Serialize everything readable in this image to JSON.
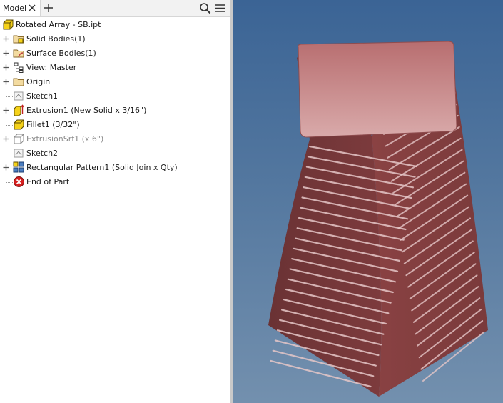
{
  "tabs": {
    "model_label": "Model"
  },
  "tree": {
    "root": "Rotated Array - SB.ipt",
    "items": [
      {
        "label": "Solid Bodies(1)",
        "icon": "solid-bodies-folder-icon",
        "expandable": true,
        "dim": false
      },
      {
        "label": "Surface Bodies(1)",
        "icon": "surface-bodies-folder-icon",
        "expandable": true,
        "dim": false
      },
      {
        "label": "View: Master",
        "icon": "view-representation-icon",
        "expandable": true,
        "dim": false
      },
      {
        "label": "Origin",
        "icon": "origin-folder-icon",
        "expandable": true,
        "dim": false
      },
      {
        "label": "Sketch1",
        "icon": "sketch-icon",
        "expandable": false,
        "dim": false
      },
      {
        "label": "Extrusion1 (New Solid x 3/16\")",
        "icon": "extrusion-icon",
        "expandable": true,
        "dim": false
      },
      {
        "label": "Fillet1 (3/32\")",
        "icon": "fillet-icon",
        "expandable": false,
        "dim": false
      },
      {
        "label": "ExtrusionSrf1 (x 6\")",
        "icon": "surface-extrusion-icon",
        "expandable": true,
        "dim": true
      },
      {
        "label": "Sketch2",
        "icon": "sketch-icon",
        "expandable": false,
        "dim": false
      },
      {
        "label": "Rectangular Pattern1 (Solid Join x Qty)",
        "icon": "rectangular-pattern-icon",
        "expandable": true,
        "dim": false
      },
      {
        "label": "End of Part",
        "icon": "end-of-part-icon",
        "expandable": false,
        "dim": false
      }
    ]
  },
  "colors": {
    "viewport_top": "#3b6495",
    "viewport_bottom": "#7390ae",
    "part_side_dark": "#6f3436",
    "part_side_mid": "#823e3f",
    "part_top": "#cf9a9b",
    "fin_highlight": "#e6c7c8",
    "part_icon_yellow": "#f5d21a"
  }
}
